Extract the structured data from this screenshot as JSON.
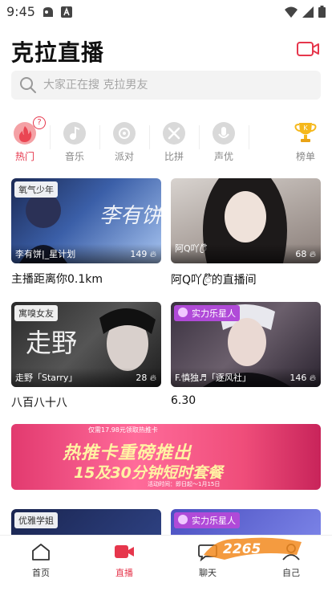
{
  "status_bar": {
    "time": "9:45"
  },
  "header": {
    "title": "克拉直播"
  },
  "search": {
    "placeholder": "大家正在搜 克拉男友"
  },
  "categories": [
    {
      "label": "热门",
      "active": true
    },
    {
      "label": "音乐"
    },
    {
      "label": "派对"
    },
    {
      "label": "比拼"
    },
    {
      "label": "声优"
    },
    {
      "label": "榜单"
    }
  ],
  "hot_badge": "?",
  "streams": [
    {
      "tag": "氧气少年",
      "host": "李有饼|_星计划",
      "count": "149",
      "caption": "主播距离你0.1km"
    },
    {
      "tag": "",
      "host": "阿Q吖ꦿ໊",
      "count": "68",
      "caption": "阿Q吖ꦿ໊的直播间"
    },
    {
      "tag": "寓嗅女友",
      "host": "走野「Starry」",
      "count": "28",
      "caption": "八百八十八"
    },
    {
      "tag": "实力乐星人",
      "host": "F.慎独♬「逐风社」",
      "count": "146",
      "caption": "6.30"
    },
    {
      "tag": "优雅学姐",
      "host": "",
      "count": "",
      "caption": ""
    },
    {
      "tag": "实力乐星人",
      "host": "",
      "count": "",
      "caption": ""
    }
  ],
  "banner": {
    "top_line": "仅需17.98元领取热推卡",
    "headline": "热推卡重磅推出",
    "subline": "15及30分钟短时套餐",
    "date_line": "活动时间：即日起～1月15日"
  },
  "bottom_nav": [
    {
      "label": "首页"
    },
    {
      "label": "直播",
      "active": true
    },
    {
      "label": "聊天"
    },
    {
      "label": "自己"
    }
  ],
  "watermark": "2265.com 手游网",
  "colors": {
    "accent": "#e6364c",
    "search_bg": "#f3f3f3"
  }
}
